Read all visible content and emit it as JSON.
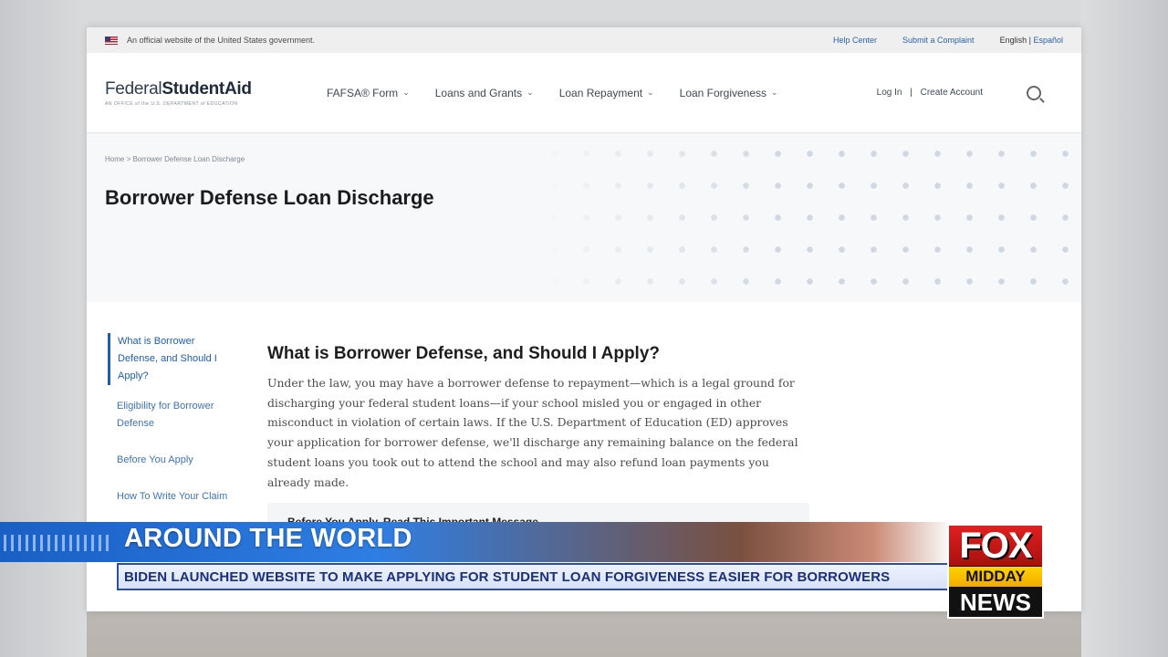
{
  "gov_banner": {
    "text": "An official website of the United States government.",
    "links": [
      "Help Center",
      "Submit a Complaint"
    ],
    "lang_en": "English",
    "lang_sep": "|",
    "lang_es": "Español"
  },
  "header": {
    "logo_light": "Federal",
    "logo_bold": "StudentAid",
    "logo_sub": "AN OFFICE of the U.S. DEPARTMENT of EDUCATION",
    "nav": [
      "FAFSA® Form",
      "Loans and Grants",
      "Loan Repayment",
      "Loan Forgiveness"
    ],
    "login": "Log In",
    "sep": "|",
    "create_account": "Create Account"
  },
  "hero": {
    "breadcrumb": "Home > Borrower Defense Loan Discharge",
    "title": "Borrower Defense Loan Discharge"
  },
  "sidenav": [
    "What is Borrower Defense, and Should I Apply?",
    "Eligibility for Borrower Defense",
    "Before You Apply",
    "How To Write Your Claim"
  ],
  "main": {
    "heading": "What is Borrower Defense, and Should I Apply?",
    "paragraph": "Under the law, you may have a borrower defense to repayment—which is a legal ground for discharging your federal student loans—if your school misled you or engaged in other misconduct in violation of certain laws. If the U.S. Department of Education (ED) approves your application for borrower defense, we'll discharge any remaining balance on the federal student loans you took out to attend the school and may also refund loan payments you already made.",
    "notice_title": "Before You Apply, Read This Important Message"
  },
  "lower_third": {
    "headline": "AROUND THE WORLD",
    "ticker": "BIDEN LAUNCHED WEBSITE TO MAKE APPLYING FOR STUDENT LOAN FORGIVENESS EASIER FOR BORROWERS"
  },
  "station_logo": {
    "line1": "FOX",
    "line2": "MIDDAY",
    "line3": "NEWS"
  },
  "colors": {
    "link_blue": "#3f73b3",
    "fox_red": "#e0201f",
    "fox_yellow": "#ffd400",
    "lower_third_blue": "#1a5fc4"
  }
}
